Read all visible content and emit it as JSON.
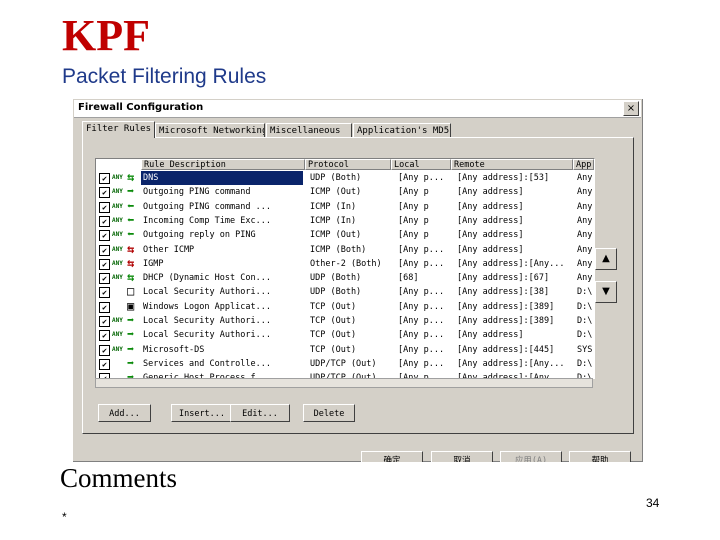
{
  "slide": {
    "title": "KPF",
    "subtitle": "Packet Filtering Rules",
    "comments": "Comments",
    "page_number": "34",
    "footnote": "*"
  },
  "window": {
    "title": "Firewall Configuration",
    "close_glyph": "×"
  },
  "tabs": [
    "Filter Rules",
    "Microsoft Networking",
    "Miscellaneous",
    "Application's MD5"
  ],
  "table": {
    "headers": [
      "Rule Description",
      "Protocol",
      "Local",
      "Remote",
      "App"
    ],
    "rows": [
      {
        "checked": true,
        "any": "ANY",
        "dir": "both",
        "dir_glyph": "⇆",
        "rule": "DNS",
        "protocol": "UDP (Both)",
        "local": "[Any p...",
        "remote": "[Any address]:[53]",
        "app": "Any",
        "selected": true
      },
      {
        "checked": true,
        "any": "ANY",
        "dir": "out",
        "dir_glyph": "➡",
        "rule": "Outgoing PING command",
        "protocol": "ICMP (Out)",
        "local": "[Any p",
        "remote": "[Any address]",
        "app": "Any",
        "selected": false
      },
      {
        "checked": true,
        "any": "ANY",
        "dir": "in",
        "dir_glyph": "⬅",
        "rule": "Outgoing PING command ...",
        "protocol": "ICMP (In)",
        "local": "[Any p",
        "remote": "[Any address]",
        "app": "Any",
        "selected": false
      },
      {
        "checked": true,
        "any": "ANY",
        "dir": "in",
        "dir_glyph": "⬅",
        "rule": "Incoming Comp Time Exc...",
        "protocol": "ICMP (In)",
        "local": "[Any p",
        "remote": "[Any address]",
        "app": "Any",
        "selected": false
      },
      {
        "checked": true,
        "any": "ANY",
        "dir": "in",
        "dir_glyph": "⬅",
        "rule": "Outgoing reply on PING",
        "protocol": "ICMP (Out)",
        "local": "[Any p",
        "remote": "[Any address]",
        "app": "Any",
        "selected": false
      },
      {
        "checked": true,
        "any": "ANY",
        "dir": "red",
        "dir_glyph": "⇆",
        "rule": "Other ICMP",
        "protocol": "ICMP (Both)",
        "local": "[Any p...",
        "remote": "[Any address]",
        "app": "Any",
        "selected": false
      },
      {
        "checked": true,
        "any": "ANY",
        "dir": "red",
        "dir_glyph": "⇆",
        "rule": "IGMP",
        "protocol": "Other-2 (Both)",
        "local": "[Any p...",
        "remote": "[Any address]:[Any...",
        "app": "Any",
        "selected": false
      },
      {
        "checked": true,
        "any": "ANY",
        "dir": "both",
        "dir_glyph": "⇆",
        "rule": "DHCP (Dynamic Host Con...",
        "protocol": "UDP (Both)",
        "local": "[68]",
        "remote": "[Any address]:[67]",
        "app": "Any",
        "selected": false
      },
      {
        "checked": true,
        "any": "",
        "dir": "none",
        "dir_glyph": "□",
        "rule": "Local Security Authori...",
        "protocol": "UDP (Both)",
        "local": "[Any p...",
        "remote": "[Any address]:[38]",
        "app": "D:\\",
        "selected": false
      },
      {
        "checked": true,
        "any": "",
        "dir": "none",
        "dir_glyph": "▣",
        "rule": "Windows Logon Applicat...",
        "protocol": "TCP (Out)",
        "local": "[Any p...",
        "remote": "[Any address]:[389]",
        "app": "D:\\",
        "selected": false
      },
      {
        "checked": true,
        "any": "ANY",
        "dir": "out",
        "dir_glyph": "➡",
        "rule": "Local Security Authori...",
        "protocol": "TCP (Out)",
        "local": "[Any p...",
        "remote": "[Any address]:[389]",
        "app": "D:\\",
        "selected": false
      },
      {
        "checked": true,
        "any": "ANY",
        "dir": "out",
        "dir_glyph": "➡",
        "rule": "Local Security Authori...",
        "protocol": "TCP (Out)",
        "local": "[Any p...",
        "remote": "[Any address]",
        "app": "D:\\",
        "selected": false
      },
      {
        "checked": true,
        "any": "ANY",
        "dir": "out",
        "dir_glyph": "➡",
        "rule": "Microsoft-DS",
        "protocol": "TCP (Out)",
        "local": "[Any p...",
        "remote": "[Any address]:[445]",
        "app": "SYS",
        "selected": false
      },
      {
        "checked": true,
        "any": "",
        "dir": "out",
        "dir_glyph": "➡",
        "rule": "Services and Controlle...",
        "protocol": "UDP/TCP (Out)",
        "local": "[Any p...",
        "remote": "[Any address]:[Any...",
        "app": "D:\\",
        "selected": false
      },
      {
        "checked": true,
        "any": "",
        "dir": "out",
        "dir_glyph": "➡",
        "rule": "Generic Host Process f...",
        "protocol": "UDP/TCP (Out)",
        "local": "[Any p...",
        "remote": "[Any address]:[Any...",
        "app": "D:\\",
        "selected": false
      }
    ]
  },
  "scroll": {
    "up_glyph": "▲",
    "down_glyph": "▼",
    "left_glyph": "◀",
    "right_glyph": "▶"
  },
  "move_buttons": {
    "up_glyph": "▲",
    "down_glyph": "▼"
  },
  "actions": [
    "Add...",
    "Insert...",
    "Edit...",
    "Delete"
  ],
  "dialog_buttons": [
    "确定",
    "取消",
    "应用(A)",
    "帮助"
  ],
  "colors": {
    "selection": "#0a246a",
    "title": "#c00000",
    "subtitle": "#1f3a8a"
  }
}
